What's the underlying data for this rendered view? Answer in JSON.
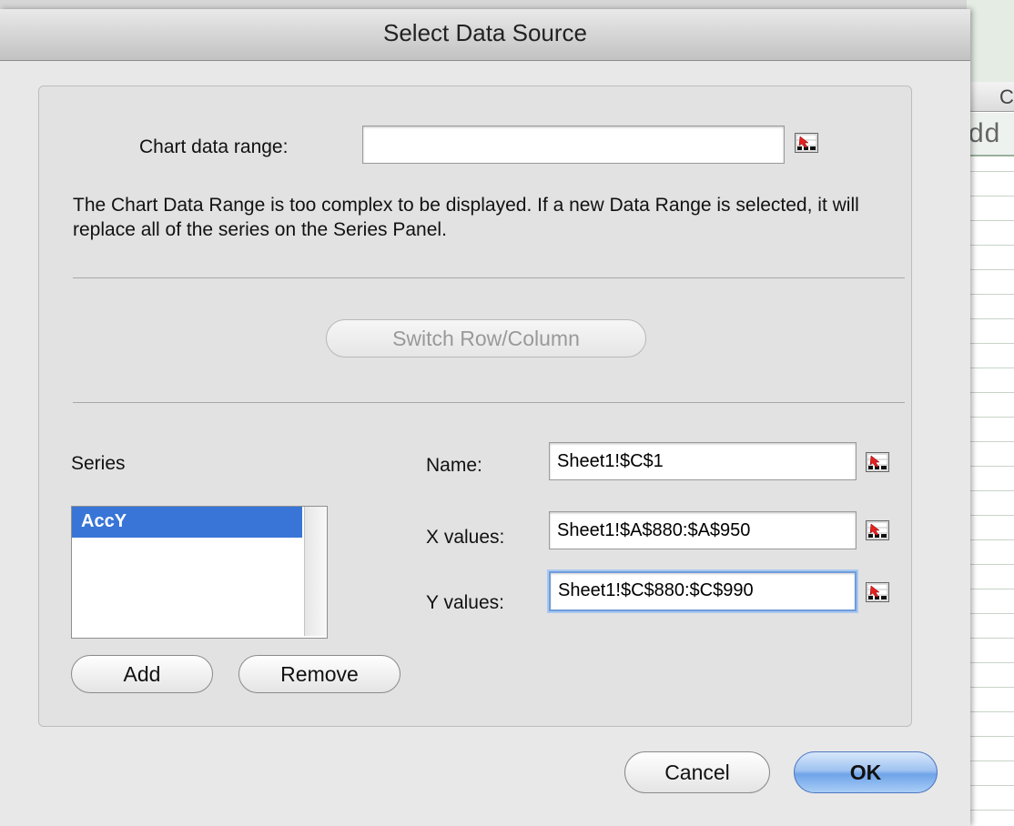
{
  "background": {
    "column_header": "C",
    "cell_text": "dd"
  },
  "dialog": {
    "title": "Select Data Source",
    "chart_range": {
      "label": "Chart data range:",
      "value": ""
    },
    "info_text": "The Chart Data Range is too complex to be displayed. If a new Data Range is selected, it will replace all of the series on the Series Panel.",
    "switch_button": "Switch Row/Column",
    "series": {
      "label": "Series",
      "items": [
        "AccY"
      ],
      "selected": "AccY"
    },
    "fields": {
      "name": {
        "label": "Name:",
        "value": "Sheet1!$C$1"
      },
      "x_values": {
        "label": "X values:",
        "value": "Sheet1!$A$880:$A$950"
      },
      "y_values": {
        "label": "Y values:",
        "value": "Sheet1!$C$880:$C$990"
      }
    },
    "add_button": "Add",
    "remove_button": "Remove",
    "cancel_button": "Cancel",
    "ok_button": "OK"
  },
  "icons": {
    "range_picker": "range-picker-icon"
  },
  "colors": {
    "selection": "#3875d7",
    "focus_ring": "#6f9ddc",
    "default_button": "#6fa4e8"
  }
}
